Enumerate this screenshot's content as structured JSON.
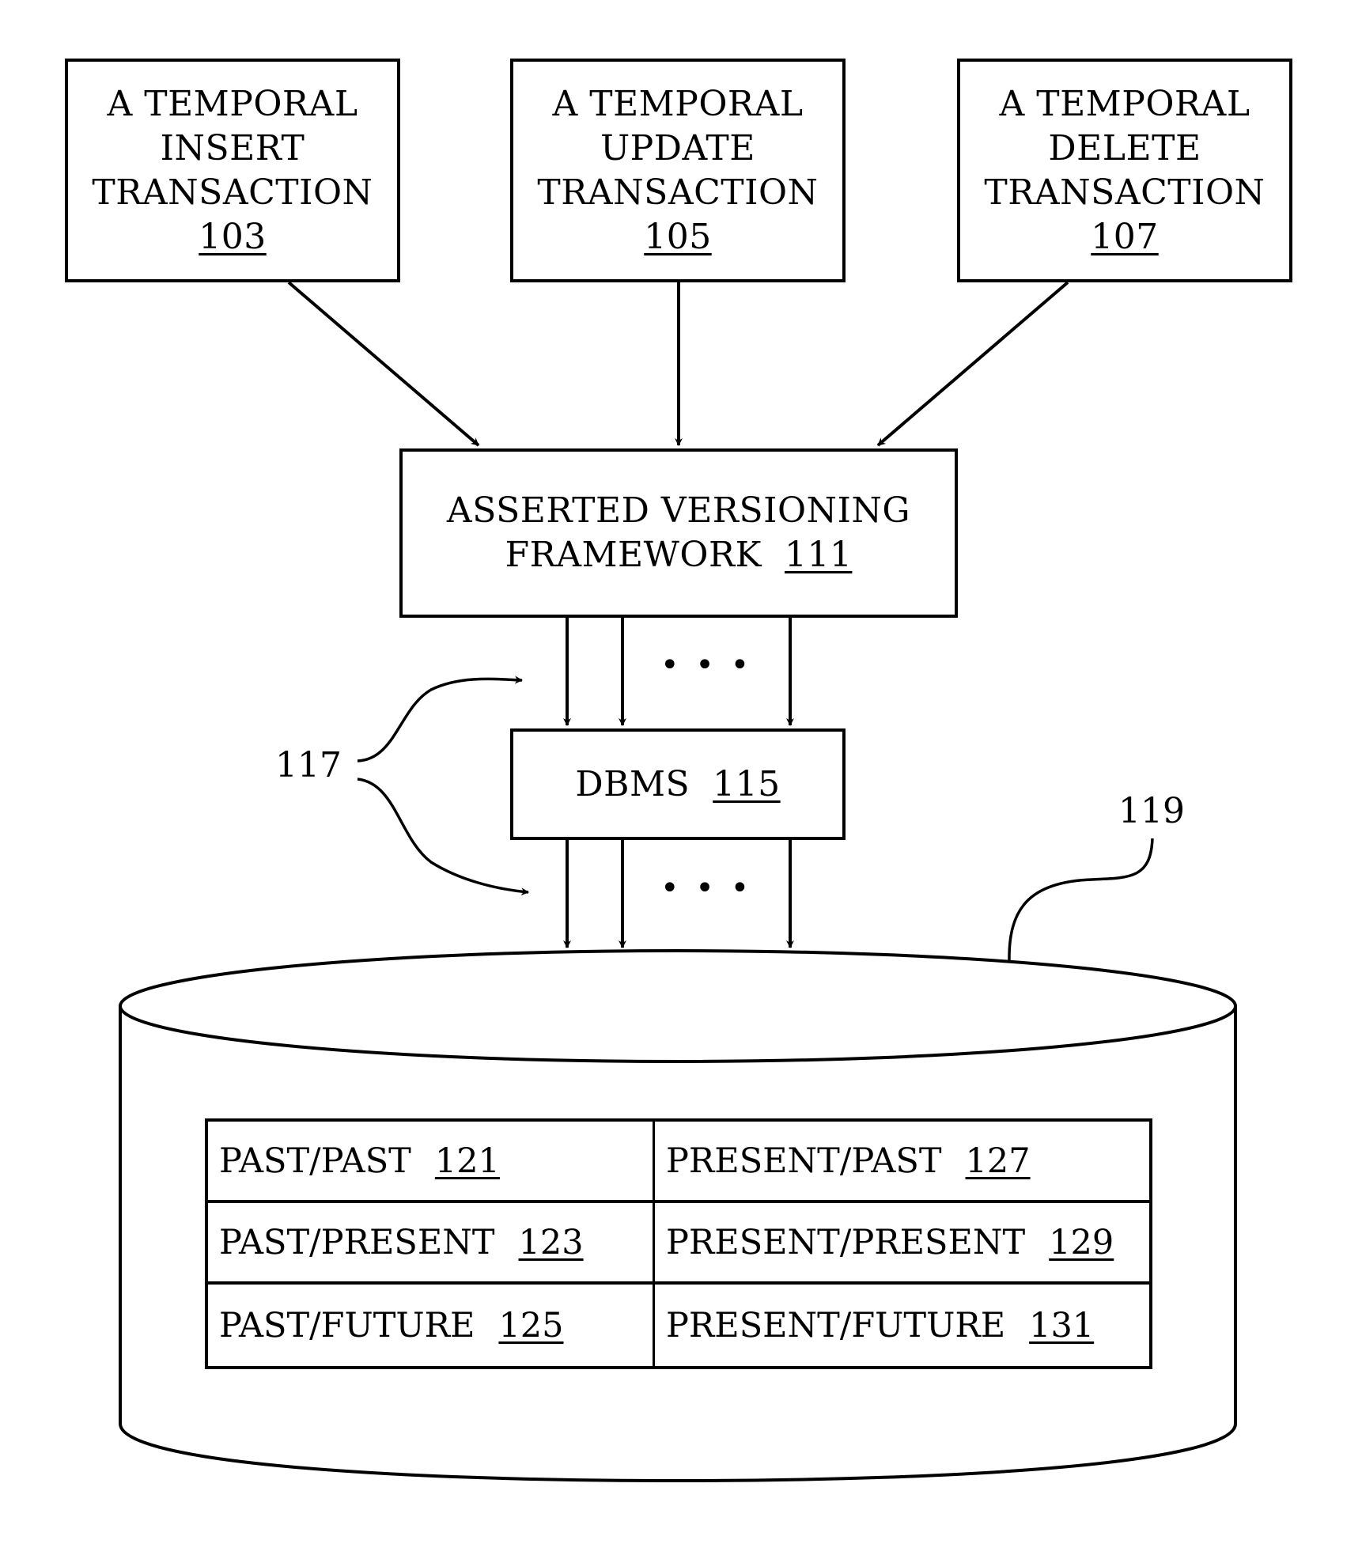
{
  "diagram": {
    "transactions": [
      {
        "lines": [
          "A TEMPORAL",
          "INSERT",
          "TRANSACTION"
        ],
        "ref": "103"
      },
      {
        "lines": [
          "A TEMPORAL",
          "UPDATE",
          "TRANSACTION"
        ],
        "ref": "105"
      },
      {
        "lines": [
          "A TEMPORAL",
          "DELETE",
          "TRANSACTION"
        ],
        "ref": "107"
      }
    ],
    "framework": {
      "lines": [
        "ASSERTED VERSIONING",
        "FRAMEWORK"
      ],
      "ref": "111"
    },
    "dbms": {
      "label": "DBMS",
      "ref": "115"
    },
    "connection_label": "117",
    "database_label": "119",
    "ellipsis": "• • •",
    "table": [
      [
        {
          "label": "PAST/PAST",
          "ref": "121"
        },
        {
          "label": "PRESENT/PAST",
          "ref": "127"
        }
      ],
      [
        {
          "label": "PAST/PRESENT",
          "ref": "123"
        },
        {
          "label": "PRESENT/PRESENT",
          "ref": "129"
        }
      ],
      [
        {
          "label": "PAST/FUTURE",
          "ref": "125"
        },
        {
          "label": "PRESENT/FUTURE",
          "ref": "131"
        }
      ]
    ]
  }
}
